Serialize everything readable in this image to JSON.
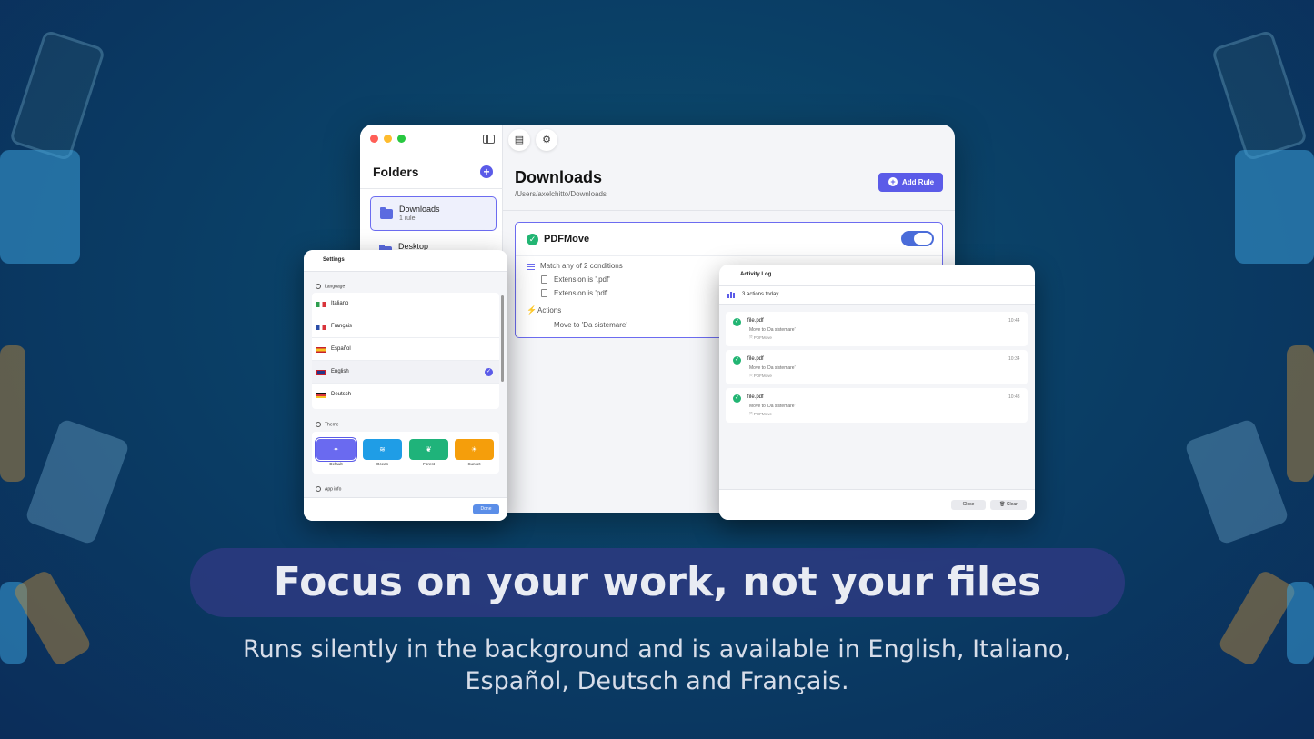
{
  "main_window": {
    "sidebar": {
      "title": "Folders",
      "add_icon": "plus-icon",
      "folders": [
        {
          "name": "Downloads",
          "sub": "1 rule",
          "selected": true
        },
        {
          "name": "Desktop",
          "sub": "",
          "selected": false
        }
      ]
    },
    "toolbar": {
      "icons": [
        "sidebar-toggle-icon",
        "activity-log-icon",
        "gear-icon"
      ]
    },
    "header": {
      "title": "Downloads",
      "path": "/Users/axelchitto/Downloads",
      "add_rule_label": "Add Rule"
    },
    "rule": {
      "name": "PDFMove",
      "enabled": true,
      "match_label": "Match any of 2 conditions",
      "conditions": [
        "Extension is '.pdf'",
        "Extension is 'pdf'"
      ],
      "actions_label": "Actions",
      "actions": [
        "Move to 'Da sistemare'"
      ]
    }
  },
  "settings_window": {
    "title": "Settings",
    "language_label": "Language",
    "languages": [
      {
        "name": "Italiano",
        "selected": false
      },
      {
        "name": "Français",
        "selected": false
      },
      {
        "name": "Español",
        "selected": false
      },
      {
        "name": "English",
        "selected": true
      },
      {
        "name": "Deutsch",
        "selected": false
      }
    ],
    "theme_label": "Theme",
    "themes": [
      {
        "name": "Default",
        "color": "#6a6af0",
        "icon": "sparkle-icon",
        "selected": true
      },
      {
        "name": "Ocean",
        "color": "#1f9de6",
        "icon": "waves-icon",
        "selected": false
      },
      {
        "name": "Forest",
        "color": "#1fb37a",
        "icon": "leaf-icon",
        "selected": false
      },
      {
        "name": "Sunset",
        "color": "#f59e0b",
        "icon": "sun-icon",
        "selected": false
      }
    ],
    "app_info_label": "App info",
    "done_label": "Done"
  },
  "activity_window": {
    "title": "Activity Log",
    "summary": "3 actions today",
    "entries": [
      {
        "file": "file.pdf",
        "action": "Move to 'Da sistemare'",
        "rule": "PDFMove",
        "time": "10:44"
      },
      {
        "file": "file.pdf",
        "action": "Move to 'Da sistemare'",
        "rule": "PDFMove",
        "time": "10:34"
      },
      {
        "file": "file.pdf",
        "action": "Move to 'Da sistemare'",
        "rule": "PDFMove",
        "time": "10:43"
      }
    ],
    "close_label": "Close",
    "clear_label": "Clear"
  },
  "headline": "Focus on your work, not your files",
  "subline_1": "Runs silently in the background and is available in English, Italiano,",
  "subline_2": "Español, Deutsch and Français.",
  "colors": {
    "accent": "#5b5be8",
    "success": "#22b573",
    "pill": "#2a3a7e"
  }
}
